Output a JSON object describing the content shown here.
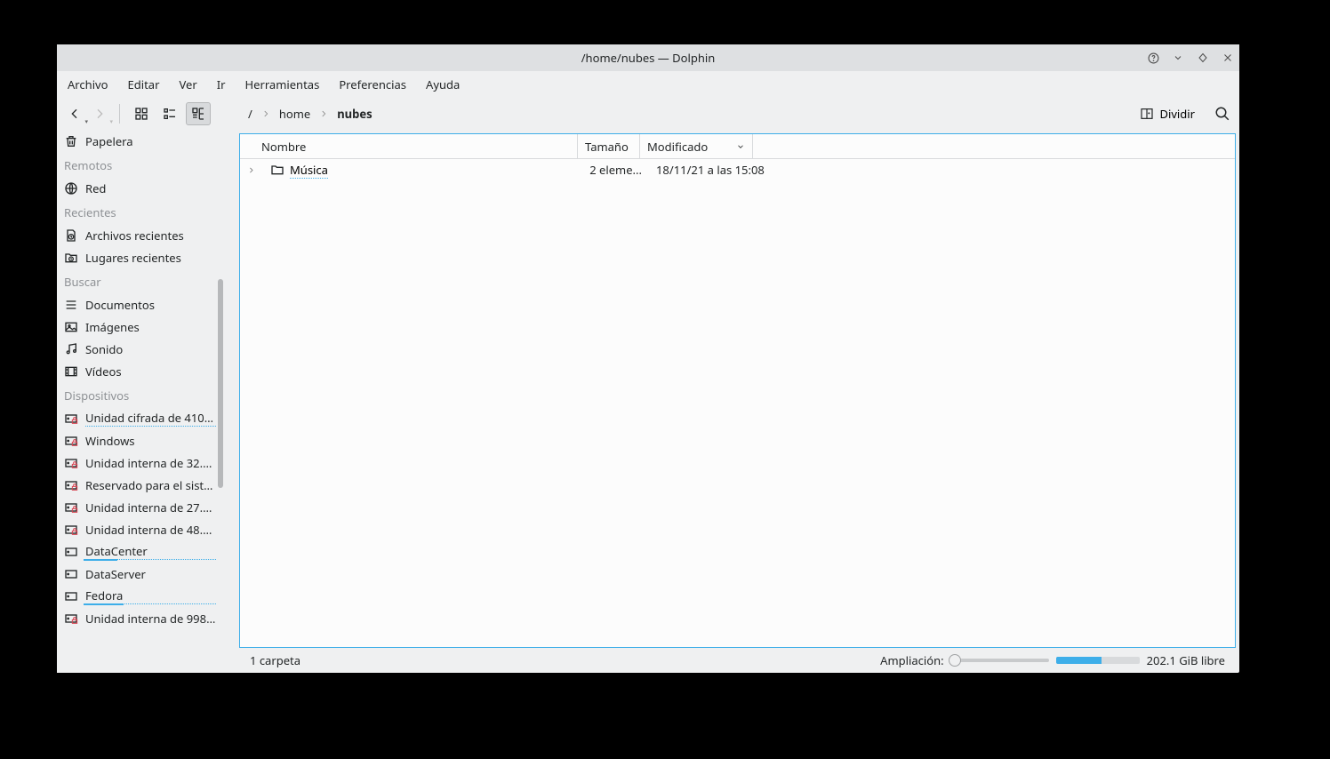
{
  "titlebar": {
    "title": "/home/nubes — Dolphin"
  },
  "menubar": {
    "items": [
      "Archivo",
      "Editar",
      "Ver",
      "Ir",
      "Herramientas",
      "Preferencias",
      "Ayuda"
    ]
  },
  "toolbar": {
    "split_label": "Dividir"
  },
  "breadcrumb": {
    "root": "/",
    "segments": [
      "home",
      "nubes"
    ]
  },
  "sidebar": {
    "trash": "Papelera",
    "section_remotes": "Remotos",
    "remotes": [
      {
        "label": "Red",
        "icon": "network"
      }
    ],
    "section_recent": "Recientes",
    "recent": [
      {
        "label": "Archivos recientes",
        "icon": "doc-recent"
      },
      {
        "label": "Lugares recientes",
        "icon": "folder-recent"
      }
    ],
    "section_search": "Buscar",
    "search": [
      {
        "label": "Documentos",
        "icon": "lines"
      },
      {
        "label": "Imágenes",
        "icon": "image"
      },
      {
        "label": "Sonido",
        "icon": "music"
      },
      {
        "label": "Vídeos",
        "icon": "video"
      }
    ],
    "section_devices": "Dispositivos",
    "devices": [
      {
        "label": "Unidad cifrada de 410.1...",
        "icon": "disk-lock",
        "underline": true
      },
      {
        "label": "Windows",
        "icon": "disk-lock"
      },
      {
        "label": "Unidad interna de 32.0 ...",
        "icon": "disk-lock"
      },
      {
        "label": "Reservado para el siste...",
        "icon": "disk-lock"
      },
      {
        "label": "Unidad interna de 27.0 ...",
        "icon": "disk-lock"
      },
      {
        "label": "Unidad interna de 48.0 ...",
        "icon": "disk-lock"
      },
      {
        "label": "DataCenter",
        "icon": "disk",
        "underline": true,
        "bar": 38
      },
      {
        "label": "DataServer",
        "icon": "disk"
      },
      {
        "label": "Fedora",
        "icon": "disk",
        "underline": true,
        "bar": 45
      },
      {
        "label": "Unidad interna de 998....",
        "icon": "disk-lock"
      }
    ]
  },
  "columns": {
    "name": "Nombre",
    "size": "Tamaño",
    "modified": "Modificado"
  },
  "files": [
    {
      "name": "Música",
      "size": "2 eleme...",
      "modified": "18/11/21 a las 15:08"
    }
  ],
  "statusbar": {
    "summary": "1 carpeta",
    "zoom_label": "Ampliación:",
    "free_space": "202.1 GiB libre",
    "free_ratio": 55
  }
}
